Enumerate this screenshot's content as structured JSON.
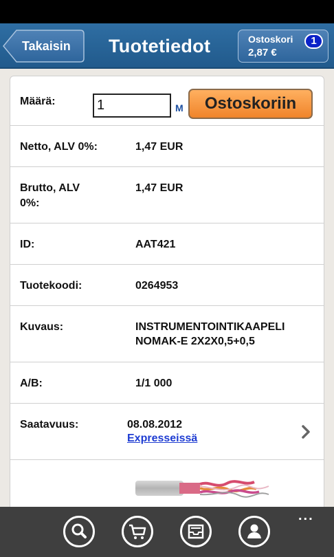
{
  "header": {
    "back_label": "Takaisin",
    "title": "Tuotetiedot",
    "cart": {
      "label": "Ostoskori",
      "total": "2,87 €",
      "count": "1"
    }
  },
  "quantity": {
    "label": "Määrä:",
    "value": "1",
    "unit": "M",
    "add_button_label": "Ostoskoriin"
  },
  "details": {
    "netto": {
      "label": "Netto, ALV 0%:",
      "value": "1,47 EUR"
    },
    "brutto": {
      "label_line1": "Brutto, ALV",
      "label_line2": "0%:",
      "value": "1,47 EUR"
    },
    "id": {
      "label": "ID:",
      "value": "AAT421"
    },
    "tuotekoodi": {
      "label": "Tuotekoodi:",
      "value": "0264953"
    },
    "kuvaus": {
      "label": "Kuvaus:",
      "value_line1": "INSTRUMENTOINTIKAAPELI",
      "value_line2": "NOMAK-E 2X2X0,5+0,5"
    },
    "ab": {
      "label": "A/B:",
      "value": "1/1 000"
    },
    "saatavuus": {
      "label": "Saatavuus:",
      "date": "08.08.2012",
      "link": "Expresseissä"
    }
  },
  "appbar": {
    "icons": [
      "search-icon",
      "cart-icon",
      "inbox-icon",
      "user-icon"
    ],
    "more": "..."
  },
  "colors": {
    "header_blue": "#2a6399",
    "accent_orange": "#f59a45",
    "badge_blue": "#0b22c8",
    "link_blue": "#1e3cd2"
  }
}
